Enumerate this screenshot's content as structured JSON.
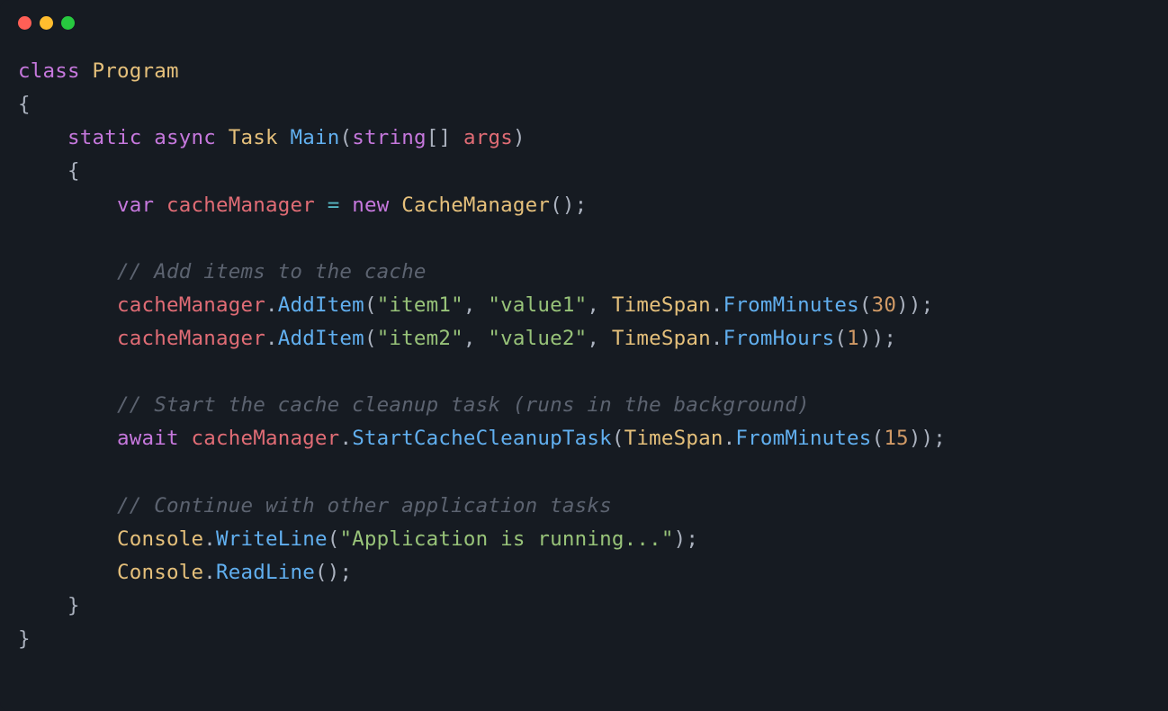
{
  "titlebar": {
    "close": "close",
    "minimize": "minimize",
    "maximize": "maximize"
  },
  "code": {
    "l1": {
      "kw_class": "class",
      "cls": "Program"
    },
    "l2": {
      "brace": "{"
    },
    "l3": {
      "kw_static": "static",
      "kw_async": "async",
      "type_task": "Task",
      "fn_main": "Main",
      "p_open": "(",
      "type_string": "string",
      "brackets": "[]",
      "id_args": "args",
      "p_close": ")"
    },
    "l4": {
      "brace": "{"
    },
    "l5": {
      "kw_var": "var",
      "id_cm": "cacheManager",
      "op_eq": "=",
      "kw_new": "new",
      "cls_cm": "CacheManager",
      "parens": "();"
    },
    "l6": {
      "cmt": "// Add items to the cache"
    },
    "l7": {
      "id_cm": "cacheManager",
      "dot": ".",
      "fn_add": "AddItem",
      "p1": "(",
      "s_item": "\"item1\"",
      "c1": ", ",
      "s_val": "\"value1\"",
      "c2": ", ",
      "cls_ts": "TimeSpan",
      "dot2": ".",
      "fn_fm": "FromMinutes",
      "p2": "(",
      "n": "30",
      "p3": "));"
    },
    "l8": {
      "id_cm": "cacheManager",
      "dot": ".",
      "fn_add": "AddItem",
      "p1": "(",
      "s_item": "\"item2\"",
      "c1": ", ",
      "s_val": "\"value2\"",
      "c2": ", ",
      "cls_ts": "TimeSpan",
      "dot2": ".",
      "fn_fh": "FromHours",
      "p2": "(",
      "n": "1",
      "p3": "));"
    },
    "l9": {
      "cmt": "// Start the cache cleanup task (runs in the background)"
    },
    "l10": {
      "kw_await": "await",
      "id_cm": "cacheManager",
      "dot": ".",
      "fn_sc": "StartCacheCleanupTask",
      "p1": "(",
      "cls_ts": "TimeSpan",
      "dot2": ".",
      "fn_fm": "FromMinutes",
      "p2": "(",
      "n": "15",
      "p3": "));"
    },
    "l11": {
      "cmt": "// Continue with other application tasks"
    },
    "l12": {
      "cls_con": "Console",
      "dot": ".",
      "fn_wl": "WriteLine",
      "p1": "(",
      "s": "\"Application is running...\"",
      "p2": ");"
    },
    "l13": {
      "cls_con": "Console",
      "dot": ".",
      "fn_rl": "ReadLine",
      "p": "();"
    },
    "l14": {
      "brace": "}"
    },
    "l15": {
      "brace": "}"
    }
  }
}
